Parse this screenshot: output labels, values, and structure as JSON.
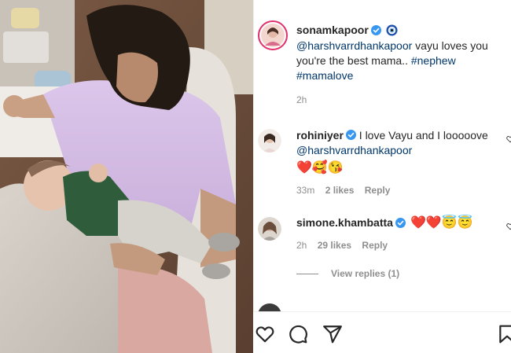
{
  "post": {
    "author": "sonamkapoor",
    "caption_mention": "@harshvarrdhankapoor",
    "caption_text": " vayu loves you you're the best mama.. ",
    "caption_tags": [
      "#nephew",
      "#mamalove"
    ],
    "time": "2h"
  },
  "comments": [
    {
      "username": "rohiniyer",
      "text": "I love Vayu and I looooove ",
      "mention": "@harshvarrdhankapoor",
      "emojis": "❤️🥰😘",
      "time": "33m",
      "likes": "2 likes",
      "reply": "Reply"
    },
    {
      "username": "simone.khambatta",
      "emojis": "❤️❤️😇😇",
      "time": "2h",
      "likes": "29 likes",
      "reply": "Reply",
      "view_replies": "View replies (1)"
    }
  ],
  "colors": {
    "verified": "#3897f0",
    "link": "#00376b",
    "meta": "#8e8e8e",
    "heart": "#ed4956"
  },
  "icons": [
    "heart-icon",
    "comment-icon",
    "share-icon",
    "bookmark-icon",
    "verified-icon",
    "evil-eye-icon"
  ]
}
